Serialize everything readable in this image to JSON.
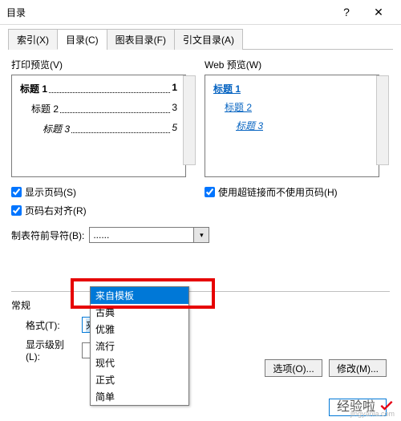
{
  "window": {
    "title": "目录",
    "help_btn": "?",
    "close_btn": "✕"
  },
  "tabs": {
    "index": "索引(X)",
    "toc": "目录(C)",
    "figures": "图表目录(F)",
    "citations": "引文目录(A)"
  },
  "print_preview": {
    "label": "打印预览(V)",
    "heading1": "标题 1",
    "heading1_page": "1",
    "heading2": "标题 2",
    "heading2_page": "3",
    "heading3": "标题 3",
    "heading3_page": "5"
  },
  "web_preview": {
    "label": "Web 预览(W)",
    "heading1": "标题 1",
    "heading2": "标题 2",
    "heading3": "标题 3"
  },
  "options": {
    "show_page_numbers": "显示页码(S)",
    "right_align_numbers": "页码右对齐(R)",
    "use_hyperlinks": "使用超链接而不使用页码(H)",
    "tab_leader_label": "制表符前导符(B):",
    "tab_leader_value": "......"
  },
  "general": {
    "group_title": "常规",
    "format_label": "格式(T):",
    "format_value": "来自模板",
    "levels_label": "显示级别(L):",
    "levels_value": "",
    "dropdown": {
      "opt0": "来自模板",
      "opt1": "古典",
      "opt2": "优雅",
      "opt3": "流行",
      "opt4": "现代",
      "opt5": "正式",
      "opt6": "简单"
    }
  },
  "buttons": {
    "options": "选项(O)...",
    "modify": "修改(M)...",
    "ok": "",
    "cancel": ""
  },
  "watermark": {
    "text": "经验啦",
    "url": "jingyanla.com"
  }
}
